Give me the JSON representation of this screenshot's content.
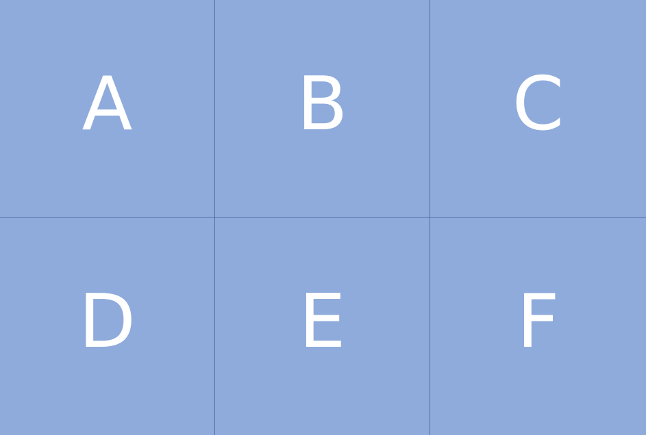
{
  "grid": {
    "background": "#8eabdc",
    "line_color": "#4f6fa8",
    "text_color": "#ffffff",
    "cells": [
      {
        "label": "A"
      },
      {
        "label": "B"
      },
      {
        "label": "C"
      },
      {
        "label": "D"
      },
      {
        "label": "E"
      },
      {
        "label": "F"
      }
    ]
  }
}
